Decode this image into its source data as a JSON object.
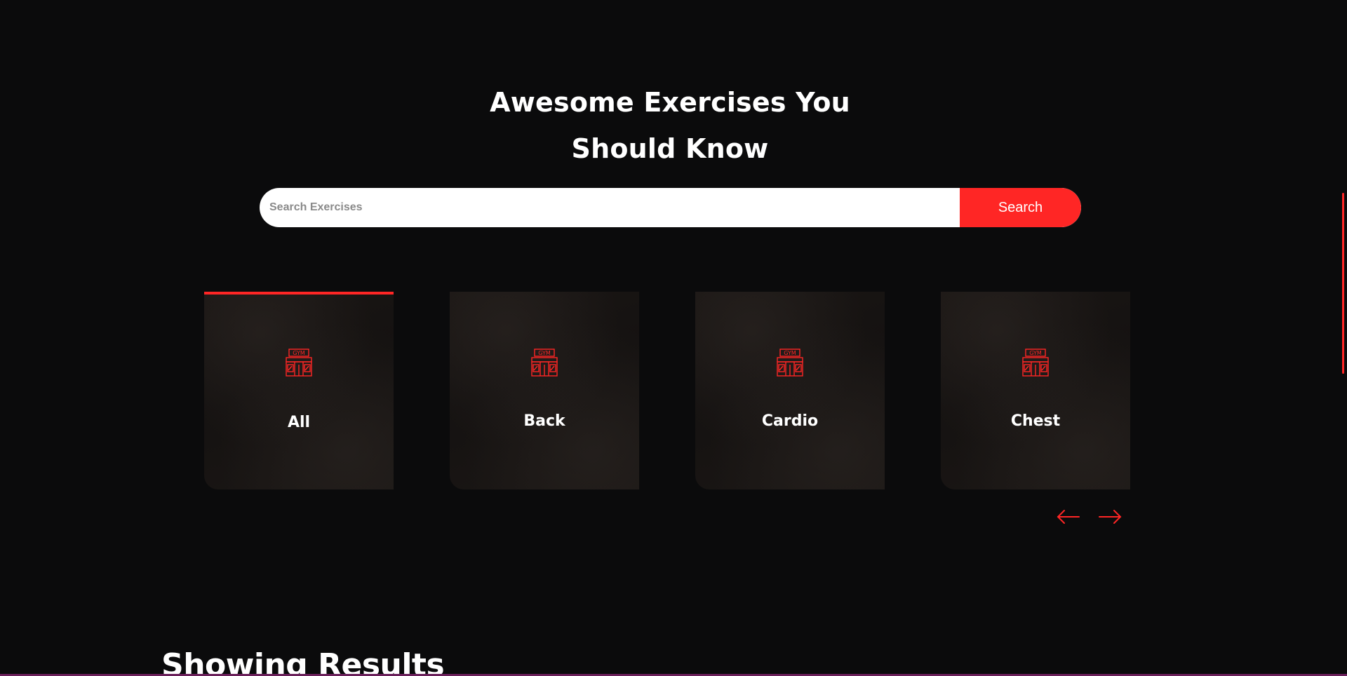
{
  "hero": {
    "title_line1": "Awesome Exercises You",
    "title_line2": "Should Know"
  },
  "search": {
    "placeholder": "Search Exercises",
    "value": "",
    "button_label": "Search"
  },
  "categories": [
    {
      "label": "All",
      "icon": "gym-icon",
      "active": true
    },
    {
      "label": "Back",
      "icon": "gym-icon",
      "active": false
    },
    {
      "label": "Cardio",
      "icon": "gym-icon",
      "active": false
    },
    {
      "label": "Chest",
      "icon": "gym-icon",
      "active": false
    }
  ],
  "carousel": {
    "prev_icon": "arrow-left-icon",
    "next_icon": "arrow-right-icon"
  },
  "results": {
    "heading": "Showing Results"
  },
  "colors": {
    "background": "#0b0b0c",
    "accent": "#ff2625",
    "text": "#ffffff"
  }
}
